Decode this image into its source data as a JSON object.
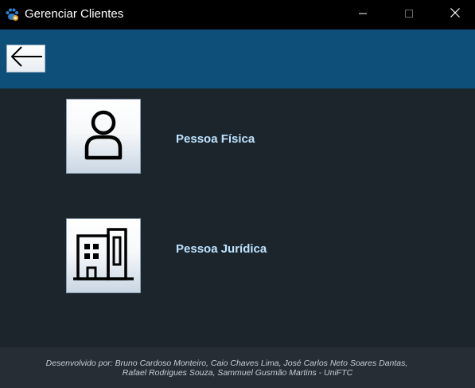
{
  "window": {
    "title": "Gerenciar Clientes",
    "icon": "paw-app-icon",
    "controls": [
      "minimize-icon",
      "maximize-icon",
      "close-icon"
    ]
  },
  "header": {
    "back_icon": "arrow-left-icon"
  },
  "options": [
    {
      "label": "Pessoa Física",
      "icon": "person-icon"
    },
    {
      "label": "Pessoa Jurídica",
      "icon": "building-icon"
    }
  ],
  "footer": {
    "line1": "Desenvolvido por: Bruno Cardoso Monteiro, Caio Chaves Lima, José Carlos Neto Soares Dantas,",
    "line2": "Rafael Rodrigues Souza, Sammuel Gusmão Martins - UniFTC"
  },
  "colors": {
    "titlebar": "#000000",
    "header": "#0e4f7a",
    "background": "#1c252c",
    "footer": "#262d35",
    "label": "#bfe3ff"
  }
}
